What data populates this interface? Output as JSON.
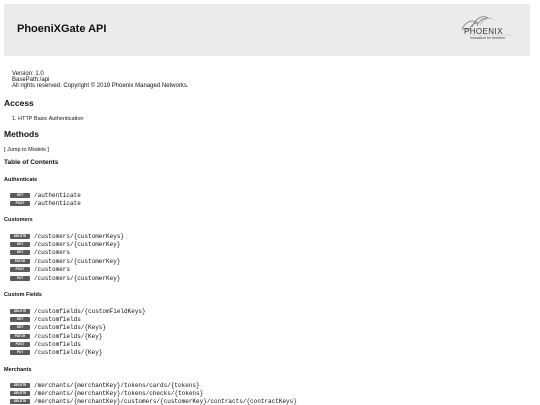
{
  "header": {
    "title": "PhoeniXGate API",
    "logo_word": "PHOENIX",
    "logo_sub": "innovation for freedom"
  },
  "meta": {
    "version": "Version: 1.0",
    "basepath": "BasePath:/api",
    "copyright": "All rights reserved. Copyright © 2019 Phoenix Managed Networks."
  },
  "access": {
    "heading": "Access",
    "item": "1. HTTP Basic Authentication"
  },
  "methods": {
    "heading": "Methods",
    "jump": "[ Jump to Models ]",
    "toc": "Table of Contents"
  },
  "sections": [
    {
      "name": "Authenticate",
      "endpoints": [
        {
          "method": "GET",
          "path": "/authenticate"
        },
        {
          "method": "POST",
          "path": "/authenticate"
        }
      ]
    },
    {
      "name": "Customers",
      "endpoints": [
        {
          "method": "DELETE",
          "path": "/customers/{customerKeys}"
        },
        {
          "method": "GET",
          "path": "/customers/{customerKey}"
        },
        {
          "method": "GET",
          "path": "/customers"
        },
        {
          "method": "PATCH",
          "path": "/customers/{customerKey}"
        },
        {
          "method": "POST",
          "path": "/customers"
        },
        {
          "method": "PUT",
          "path": "/customers/{customerKey}"
        }
      ]
    },
    {
      "name": "Custom Fields",
      "endpoints": [
        {
          "method": "DELETE",
          "path": "/customfields/{customFieldKeys}"
        },
        {
          "method": "GET",
          "path": "/customfields"
        },
        {
          "method": "GET",
          "path": "/customfields/{Keys}"
        },
        {
          "method": "PATCH",
          "path": "/customfields/{Key}"
        },
        {
          "method": "POST",
          "path": "/customfields"
        },
        {
          "method": "PUT",
          "path": "/customfields/{Key}"
        }
      ]
    },
    {
      "name": "Merchants",
      "endpoints": [
        {
          "method": "DELETE",
          "path": "/merchants/{merchantKey}/tokens/cards/{tokens}"
        },
        {
          "method": "DELETE",
          "path": "/merchants/{merchantKey}/tokens/checks/{tokens}"
        },
        {
          "method": "DELETE",
          "path": "/merchants/{merchantKey}/customers/{customerKey}/contracts/{contractKeys}"
        }
      ]
    }
  ]
}
